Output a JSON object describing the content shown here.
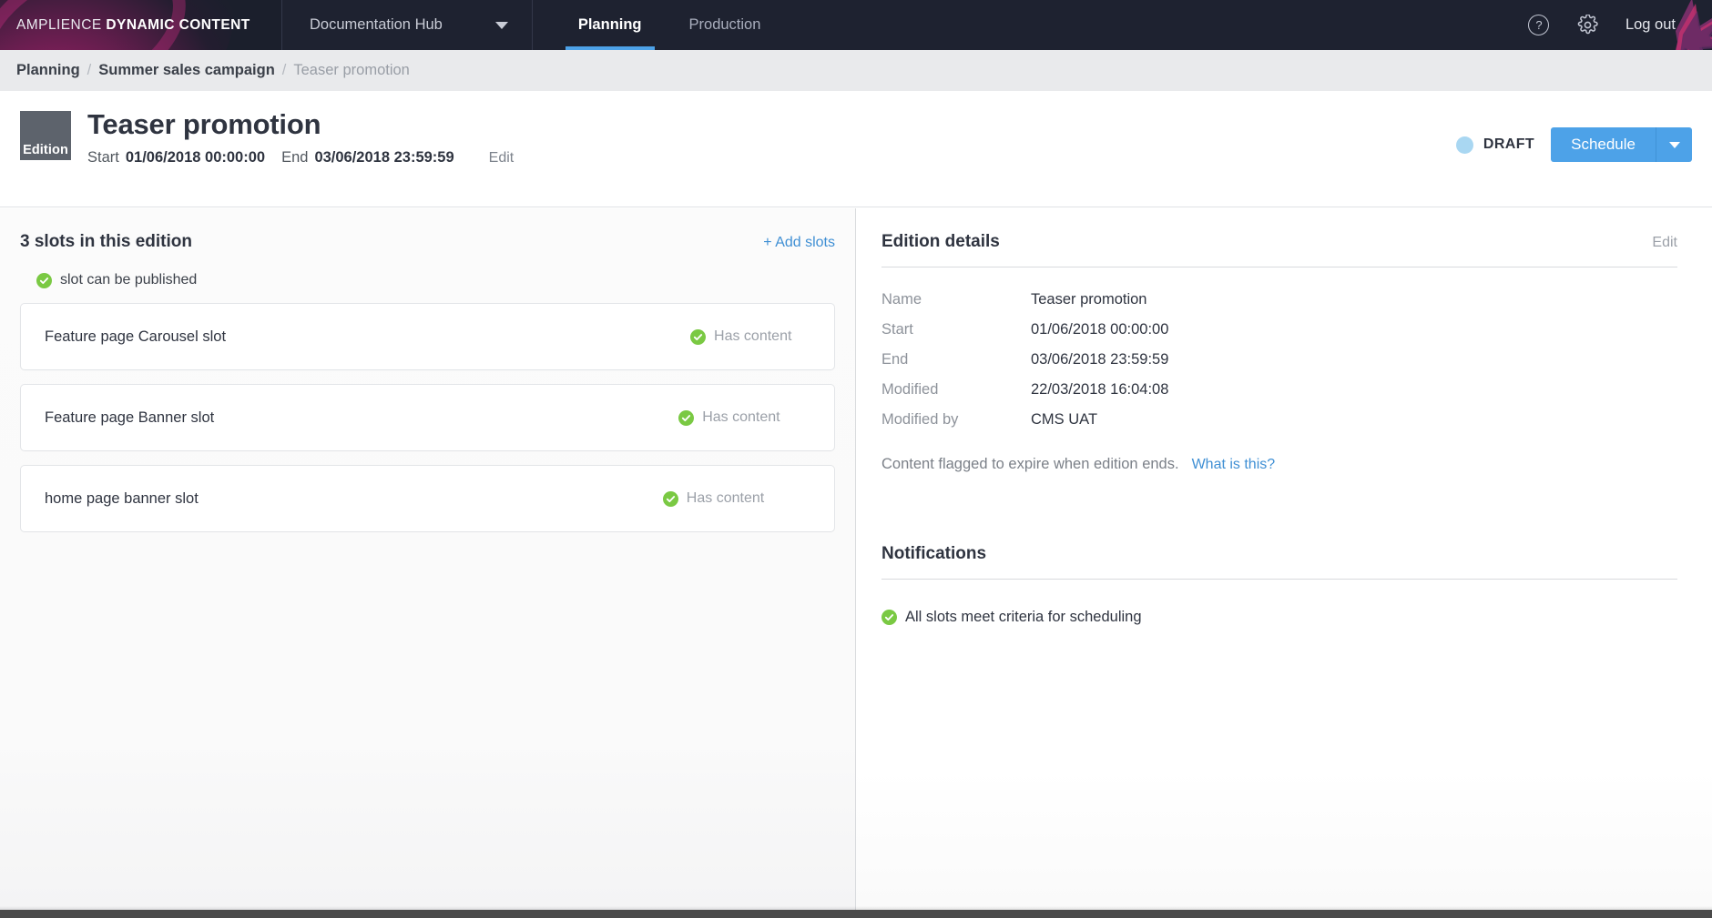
{
  "topnav": {
    "brand_light": "AMPLIENCE ",
    "brand_bold": "DYNAMIC CONTENT",
    "hub_label": "Documentation Hub",
    "hub_caret_icon": "chevron-down-icon",
    "tabs": [
      {
        "label": "Planning",
        "active": true
      },
      {
        "label": "Production",
        "active": false
      }
    ],
    "help_icon": "question-mark-circle-icon",
    "help_glyph": "?",
    "settings_icon": "gear-icon",
    "logout_label": "Log out",
    "accent_color": "#4da2e8",
    "background_color": "#1e2230"
  },
  "breadcrumb": {
    "items": [
      {
        "label": "Planning",
        "current": false
      },
      {
        "label": "Summer sales campaign",
        "current": false
      },
      {
        "label": "Teaser promotion",
        "current": true
      }
    ],
    "separator": "/"
  },
  "page_header": {
    "badge_label": "Edition",
    "badge_color": "#5d636c",
    "title": "Teaser promotion",
    "start_label": "Start",
    "start_value": "01/06/2018 00:00:00",
    "end_label": "End",
    "end_value": "03/06/2018 23:59:59",
    "edit_label": "Edit",
    "status_label": "DRAFT",
    "status_dot_color": "#a9d7f2",
    "primary_button": "Schedule",
    "primary_button_color": "#4da2e8",
    "dropdown_icon": "chevron-down-icon"
  },
  "slots_panel": {
    "title": "3 slots in this edition",
    "add_link": "+ Add slots",
    "legend_icon": "green-check-icon",
    "legend_label": "slot can be published",
    "status_icon": "green-check-icon",
    "items": [
      {
        "name": "Feature page Carousel slot",
        "status": "Has content"
      },
      {
        "name": "Feature page Banner slot",
        "status": "Has content"
      },
      {
        "name": "home page banner slot",
        "status": "Has content"
      }
    ]
  },
  "details_panel": {
    "title": "Edition details",
    "edit_label": "Edit",
    "rows": [
      {
        "key": "Name",
        "value": "Teaser promotion"
      },
      {
        "key": "Start",
        "value": "01/06/2018 00:00:00"
      },
      {
        "key": "End",
        "value": "03/06/2018 23:59:59"
      },
      {
        "key": "Modified",
        "value": "22/03/2018 16:04:08"
      },
      {
        "key": "Modified by",
        "value": "CMS UAT"
      }
    ],
    "expire_note": "Content flagged to expire when edition ends.",
    "expire_link": "What is this?"
  },
  "notifications_panel": {
    "title": "Notifications",
    "icon": "green-check-icon",
    "message": "All slots meet criteria for scheduling"
  }
}
